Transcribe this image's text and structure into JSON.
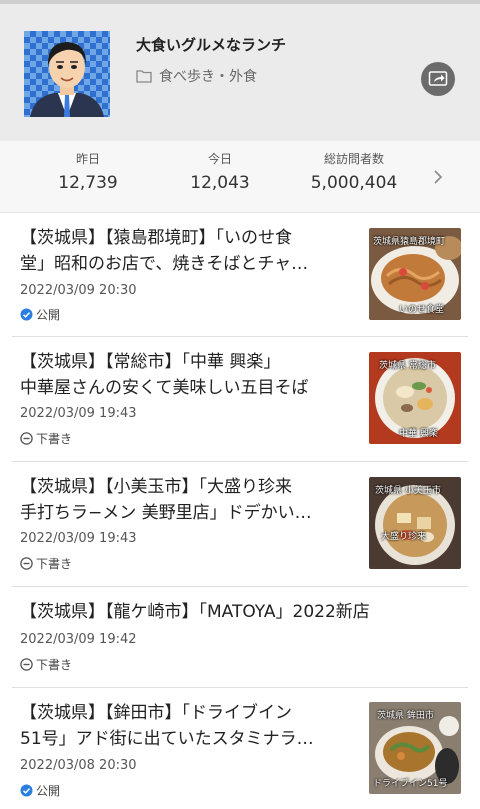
{
  "blog": {
    "title": "大食いグルメなランチ",
    "category": "食べ歩き・外食"
  },
  "stats": [
    {
      "label": "昨日",
      "value": "12,739"
    },
    {
      "label": "今日",
      "value": "12,043"
    },
    {
      "label": "総訪問者数",
      "value": "5,000,404"
    }
  ],
  "posts": [
    {
      "line1": "【茨城県】【猿島郡境町】「いのせ食",
      "line2": "堂」昭和のお店で、焼きそばとチャ…",
      "date": "2022/03/09 20:30",
      "status": "公開",
      "status_type": "published",
      "thumb": {
        "icon": "yakisoba-photo",
        "caption_top": "茨城県猿島郡境町",
        "caption_bottom": "いのせ食堂"
      }
    },
    {
      "line1": "【茨城県】【常総市】「中華 興楽」",
      "line2": "中華屋さんの安くて美味しい五目そば",
      "date": "2022/03/09 19:43",
      "status": "下書き",
      "status_type": "draft",
      "thumb": {
        "icon": "gomoku-soba-photo",
        "caption_top": "茨城県 常総市",
        "caption_bottom": "中華 興楽"
      }
    },
    {
      "line1": "【茨城県】【小美玉市】「大盛り珍来",
      "line2": "手打ちラ−メン 美野里店」ドデかい…",
      "date": "2022/03/09 19:43",
      "status": "下書き",
      "status_type": "draft",
      "thumb": {
        "icon": "ramen-photo",
        "caption_top": "茨城県 小美玉市",
        "caption_bottom": "大盛り珍来"
      }
    },
    {
      "line1": "【茨城県】【龍ケ崎市】「MATOYA」2022新店",
      "line2": "",
      "date": "2022/03/09 19:42",
      "status": "下書き",
      "status_type": "draft",
      "thumb": null
    },
    {
      "line1": "【茨城県】【鉾田市】「ドライブイン",
      "line2": "51号」アド街に出ていたスタミナラ…",
      "date": "2022/03/08 20:30",
      "status": "公開",
      "status_type": "published",
      "thumb": {
        "icon": "stamina-ramen-photo",
        "caption_top": "茨城県 鉾田市",
        "caption_bottom": "ドライブイン51号"
      }
    }
  ],
  "colors": {
    "header_bg": "#ebebeb",
    "published_icon": "#2b7de0",
    "draft_icon": "#555555"
  }
}
